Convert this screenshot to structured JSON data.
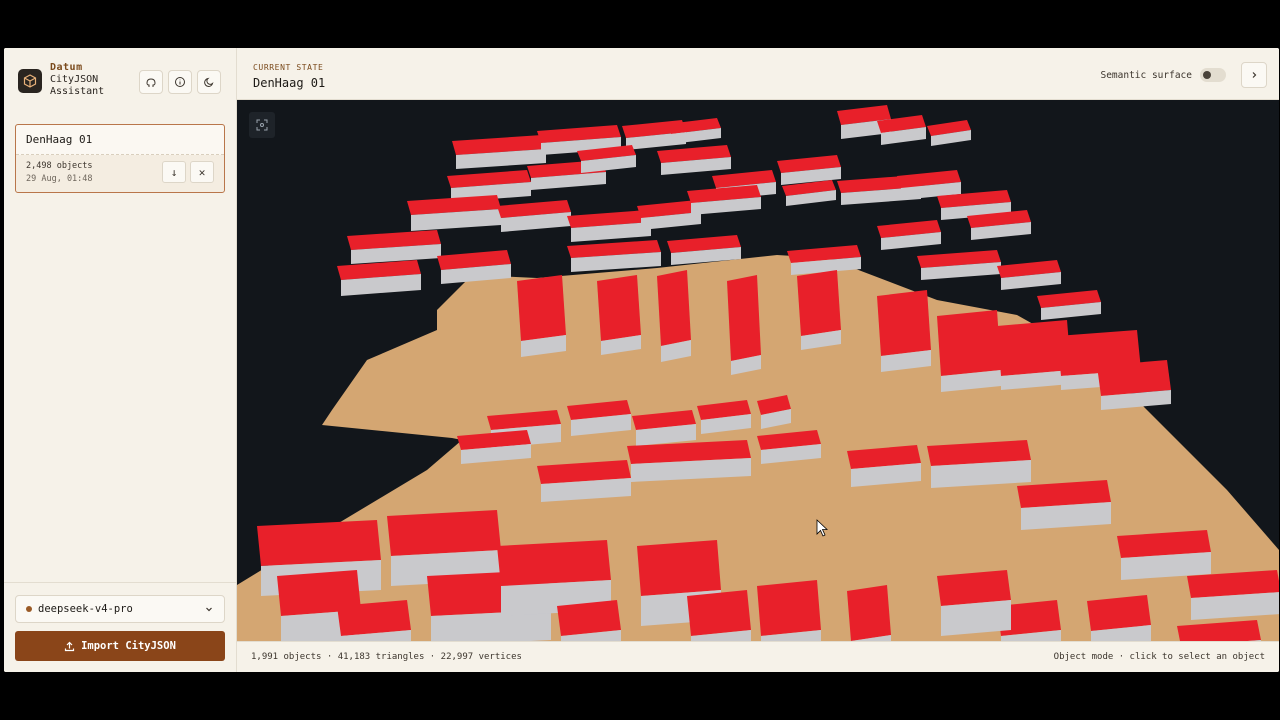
{
  "brand": {
    "name": "Datum",
    "subtitle_line1": "CityJSON",
    "subtitle_line2": "Assistant"
  },
  "top_icons": [
    "github-icon",
    "info-icon",
    "moon-icon"
  ],
  "dataset": {
    "name": "DenHaag 01",
    "objects": "2,498 objects",
    "date": "29 Aug, 01:48",
    "download_glyph": "↓",
    "remove_glyph": "✕"
  },
  "model_select": {
    "value": "deepseek-v4-pro"
  },
  "import_button": {
    "label": "Import CityJSON"
  },
  "header": {
    "state_label": "CURRENT STATE",
    "state_name": "DenHaag 01",
    "semantic_label": "Semantic surface",
    "semantic_on": false
  },
  "status": {
    "stats": "1,991 objects · 41,183 triangles · 22,997 vertices",
    "mode": "Object mode · click to select an object"
  },
  "colors": {
    "accent": "#8a4519",
    "roof": "#e8202a",
    "wall": "#c9c9cc",
    "ground": "#d4a672",
    "viewport_bg": "#12161b"
  }
}
